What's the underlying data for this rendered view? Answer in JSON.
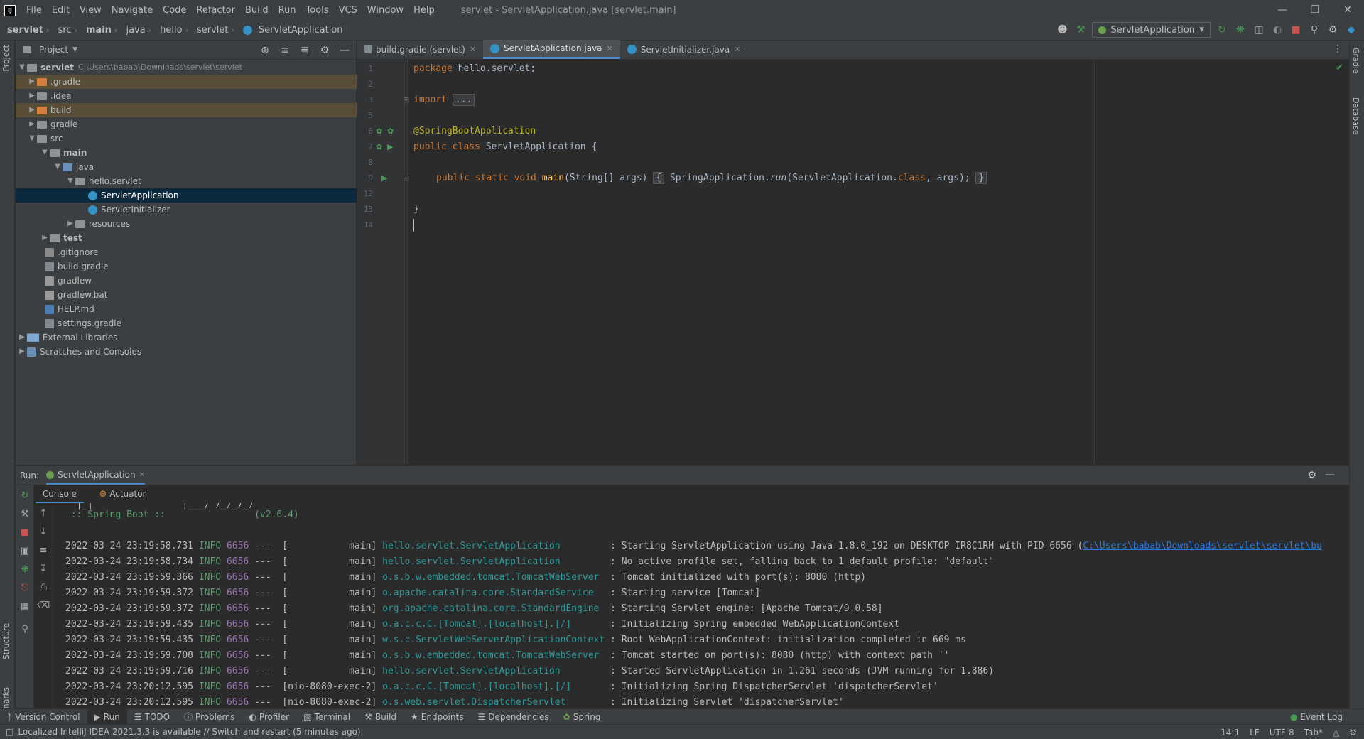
{
  "menu": [
    "File",
    "Edit",
    "View",
    "Navigate",
    "Code",
    "Refactor",
    "Build",
    "Run",
    "Tools",
    "VCS",
    "Window",
    "Help"
  ],
  "window_title": "servlet - ServletApplication.java [servlet.main]",
  "breadcrumbs": [
    "servlet",
    "src",
    "main",
    "java",
    "hello",
    "servlet",
    "ServletApplication"
  ],
  "run_config": "ServletApplication",
  "project_panel": {
    "title": "Project",
    "root_path": "C:\\Users\\babab\\Downloads\\servlet\\servlet",
    "items": [
      {
        "label": "servlet"
      },
      {
        "label": ".gradle"
      },
      {
        "label": ".idea"
      },
      {
        "label": "build"
      },
      {
        "label": "gradle"
      },
      {
        "label": "src"
      },
      {
        "label": "main"
      },
      {
        "label": "java"
      },
      {
        "label": "hello.servlet"
      },
      {
        "label": "ServletApplication"
      },
      {
        "label": "ServletInitializer"
      },
      {
        "label": "resources"
      },
      {
        "label": "test"
      },
      {
        "label": ".gitignore"
      },
      {
        "label": "build.gradle"
      },
      {
        "label": "gradlew"
      },
      {
        "label": "gradlew.bat"
      },
      {
        "label": "HELP.md"
      },
      {
        "label": "settings.gradle"
      },
      {
        "label": "External Libraries"
      },
      {
        "label": "Scratches and Consoles"
      }
    ]
  },
  "editor_tabs": [
    "build.gradle (servlet)",
    "ServletApplication.java",
    "ServletInitializer.java"
  ],
  "line_numbers": [
    "1",
    "2",
    "3",
    "5",
    "6",
    "7",
    "8",
    "9",
    "12",
    "13",
    "14"
  ],
  "code": {
    "l1_kw": "package",
    "l1_rest": " hello.servlet;",
    "l3_kw": "import",
    "l3_fold": "...",
    "l6": "@SpringBootApplication",
    "l7_kw": "public class",
    "l7_rest": " ServletApplication {",
    "l9_kw": "public static void",
    "l9_fn": "main",
    "l9_args": "(String[] args)",
    "l9_b1": "{",
    "l9_body1": " SpringApplication.",
    "l9_run": "run",
    "l9_body2": "(ServletApplication.",
    "l9_class": "class",
    "l9_body3": ", args);",
    "l9_b2": "}",
    "l13": "}"
  },
  "run_panel": {
    "label": "Run:",
    "tab": "ServletApplication",
    "subtabs": [
      "Console",
      "Actuator"
    ],
    "banner_partial": "  |_|                |___/ /_/_/_/",
    "banner": " :: Spring Boot ::                (v2.6.4)",
    "logs": [
      {
        "time": "2022-03-24 23:19:58.731",
        "level": "INFO",
        "pid": "6656",
        "thread": "---  [           main]",
        "logger": "hello.servlet.ServletApplication        ",
        "msg": " : Starting ServletApplication using Java 1.8.0_192 on DESKTOP-IR8C1RH with PID 6656 (",
        "link": "C:\\Users\\babab\\Downloads\\servlet\\servlet\\bu"
      },
      {
        "time": "2022-03-24 23:19:58.734",
        "level": "INFO",
        "pid": "6656",
        "thread": "---  [           main]",
        "logger": "hello.servlet.ServletApplication        ",
        "msg": " : No active profile set, falling back to 1 default profile: \"default\"",
        "link": ""
      },
      {
        "time": "2022-03-24 23:19:59.366",
        "level": "INFO",
        "pid": "6656",
        "thread": "---  [           main]",
        "logger": "o.s.b.w.embedded.tomcat.TomcatWebServer ",
        "msg": " : Tomcat initialized with port(s): 8080 (http)",
        "link": ""
      },
      {
        "time": "2022-03-24 23:19:59.372",
        "level": "INFO",
        "pid": "6656",
        "thread": "---  [           main]",
        "logger": "o.apache.catalina.core.StandardService  ",
        "msg": " : Starting service [Tomcat]",
        "link": ""
      },
      {
        "time": "2022-03-24 23:19:59.372",
        "level": "INFO",
        "pid": "6656",
        "thread": "---  [           main]",
        "logger": "org.apache.catalina.core.StandardEngine ",
        "msg": " : Starting Servlet engine: [Apache Tomcat/9.0.58]",
        "link": ""
      },
      {
        "time": "2022-03-24 23:19:59.435",
        "level": "INFO",
        "pid": "6656",
        "thread": "---  [           main]",
        "logger": "o.a.c.c.C.[Tomcat].[localhost].[/]      ",
        "msg": " : Initializing Spring embedded WebApplicationContext",
        "link": ""
      },
      {
        "time": "2022-03-24 23:19:59.435",
        "level": "INFO",
        "pid": "6656",
        "thread": "---  [           main]",
        "logger": "w.s.c.ServletWebServerApplicationContext",
        "msg": " : Root WebApplicationContext: initialization completed in 669 ms",
        "link": ""
      },
      {
        "time": "2022-03-24 23:19:59.708",
        "level": "INFO",
        "pid": "6656",
        "thread": "---  [           main]",
        "logger": "o.s.b.w.embedded.tomcat.TomcatWebServer ",
        "msg": " : Tomcat started on port(s): 8080 (http) with context path ''",
        "link": ""
      },
      {
        "time": "2022-03-24 23:19:59.716",
        "level": "INFO",
        "pid": "6656",
        "thread": "---  [           main]",
        "logger": "hello.servlet.ServletApplication        ",
        "msg": " : Started ServletApplication in 1.261 seconds (JVM running for 1.886)",
        "link": ""
      },
      {
        "time": "2022-03-24 23:20:12.595",
        "level": "INFO",
        "pid": "6656",
        "thread": "---  [nio-8080-exec-2]",
        "logger": "o.a.c.c.C.[Tomcat].[localhost].[/]      ",
        "msg": " : Initializing Spring DispatcherServlet 'dispatcherServlet'",
        "link": ""
      },
      {
        "time": "2022-03-24 23:20:12.595",
        "level": "INFO",
        "pid": "6656",
        "thread": "---  [nio-8080-exec-2]",
        "logger": "o.s.web.servlet.DispatcherServlet       ",
        "msg": " : Initializing Servlet 'dispatcherServlet'",
        "link": ""
      }
    ]
  },
  "side_tabs_left": [
    "Project",
    "Structure",
    "Bookmarks"
  ],
  "side_tabs_right": [
    "Gradle",
    "Database"
  ],
  "bottom_tools": [
    "Version Control",
    "Run",
    "TODO",
    "Problems",
    "Profiler",
    "Terminal",
    "Build",
    "Endpoints",
    "Dependencies",
    "Spring"
  ],
  "event_log": "Event Log",
  "status": {
    "message": "Localized IntelliJ IDEA 2021.3.3 is available // Switch and restart (5 minutes ago)",
    "position": "14:1",
    "line_sep": "LF",
    "encoding": "UTF-8",
    "indent": "Tab*"
  }
}
